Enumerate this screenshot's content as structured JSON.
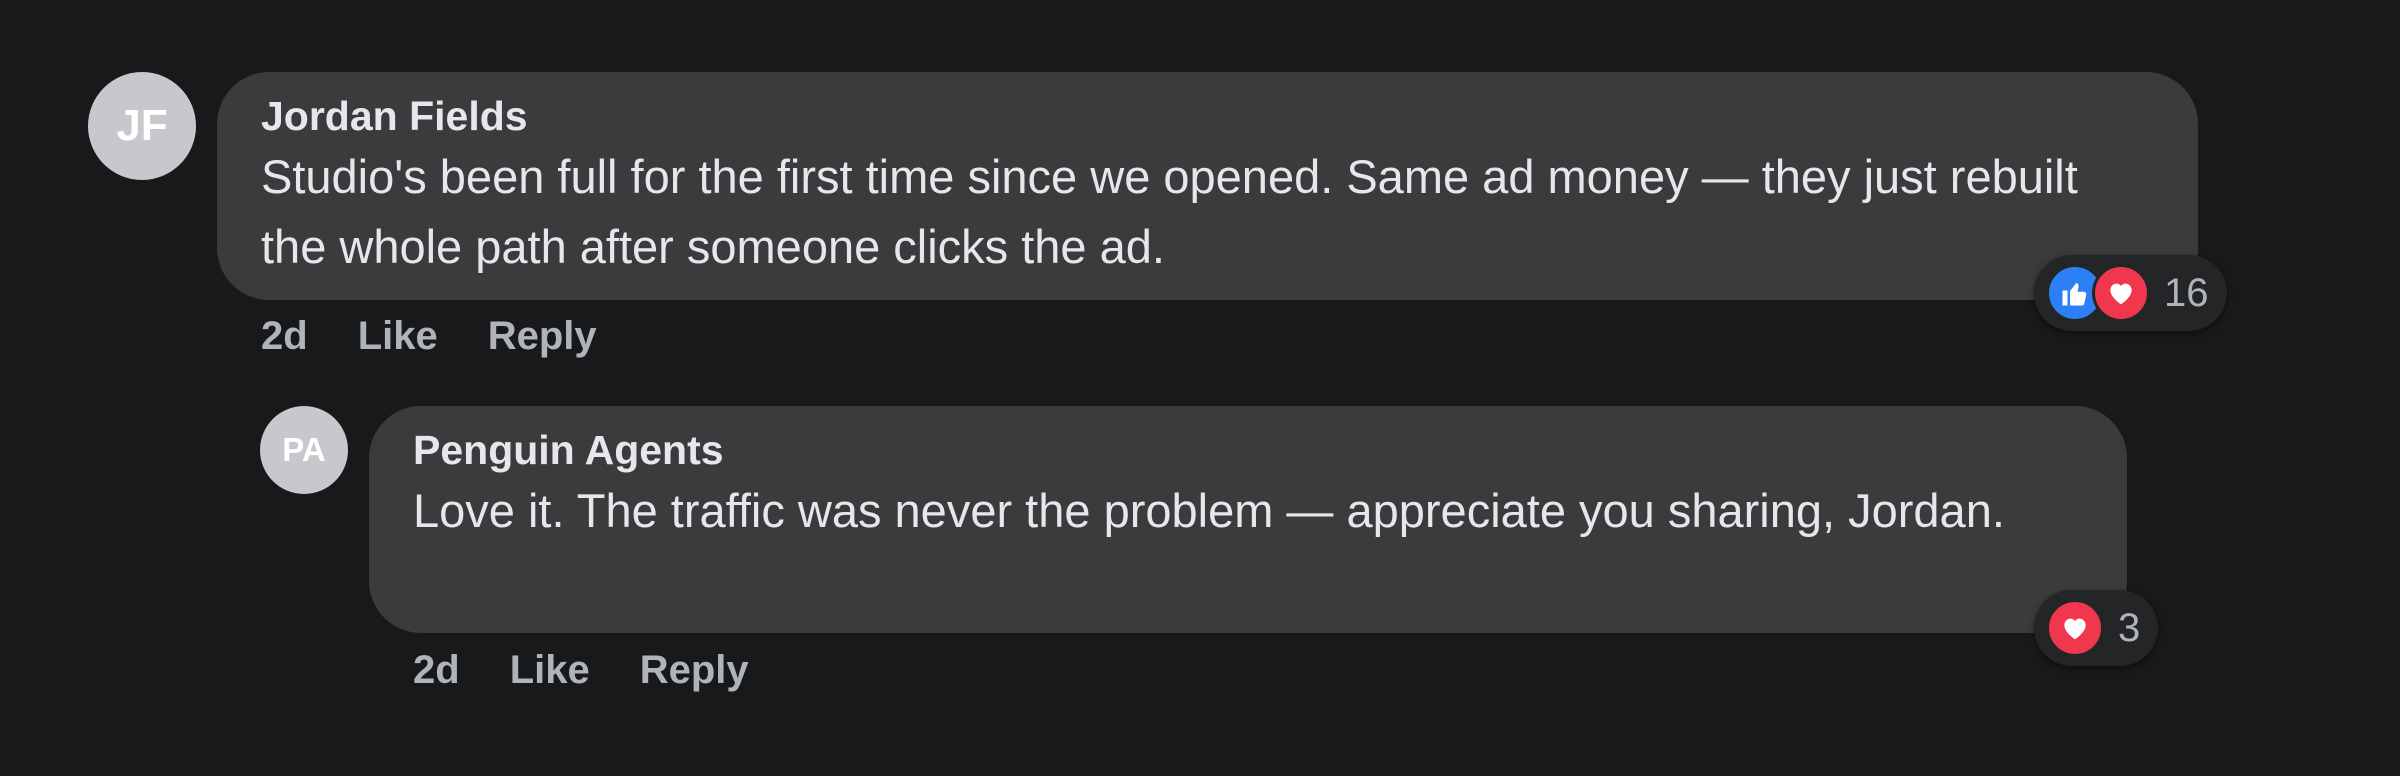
{
  "comments": [
    {
      "avatar_initials": "JF",
      "author": "Jordan Fields",
      "text": "Studio's been full for the first time since we opened. Same ad money — they just rebuilt the whole path after someone clicks the ad.",
      "time": "2d",
      "like_label": "Like",
      "reply_label": "Reply",
      "reactions": [
        "like-icon",
        "heart-icon"
      ],
      "reaction_count": "16"
    },
    {
      "avatar_initials": "PA",
      "author": "Penguin Agents",
      "text": "Love it. The traffic was never the problem — appreciate you sharing, Jordan.",
      "time": "2d",
      "like_label": "Like",
      "reply_label": "Reply",
      "reactions": [
        "heart-icon"
      ],
      "reaction_count": "3"
    }
  ],
  "colors": {
    "background": "#18191b",
    "bubble": "#3a3b3d",
    "like_blue": "#2d7ff6",
    "love_red": "#f0374d"
  }
}
